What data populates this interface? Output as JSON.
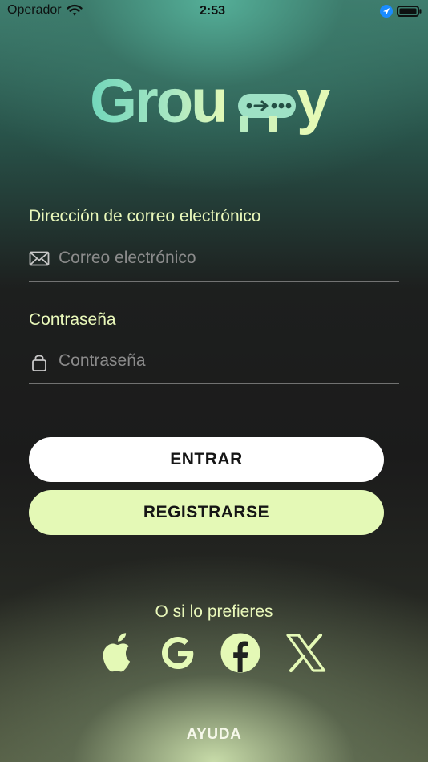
{
  "status_bar": {
    "carrier": "Operador",
    "time": "2:53",
    "icons": [
      "wifi-icon",
      "location-arrow-icon",
      "battery-icon"
    ]
  },
  "brand": {
    "logo_text": "Grouppy",
    "accent_color": "#e4f9b6",
    "logo_color": "#72d7bb"
  },
  "form": {
    "email": {
      "label": "Dirección de correo electrónico",
      "placeholder": "Correo electrónico",
      "value": "",
      "icon": "mail-icon"
    },
    "password": {
      "label": "Contraseña",
      "placeholder": "Contraseña",
      "value": "",
      "icon": "lock-icon"
    }
  },
  "buttons": {
    "login": "ENTRAR",
    "register": "REGISTRARSE"
  },
  "social": {
    "prompt": "O si lo prefieres",
    "providers": [
      "apple-icon",
      "google-icon",
      "facebook-icon",
      "x-icon"
    ]
  },
  "footer": {
    "help": "AYUDA"
  }
}
